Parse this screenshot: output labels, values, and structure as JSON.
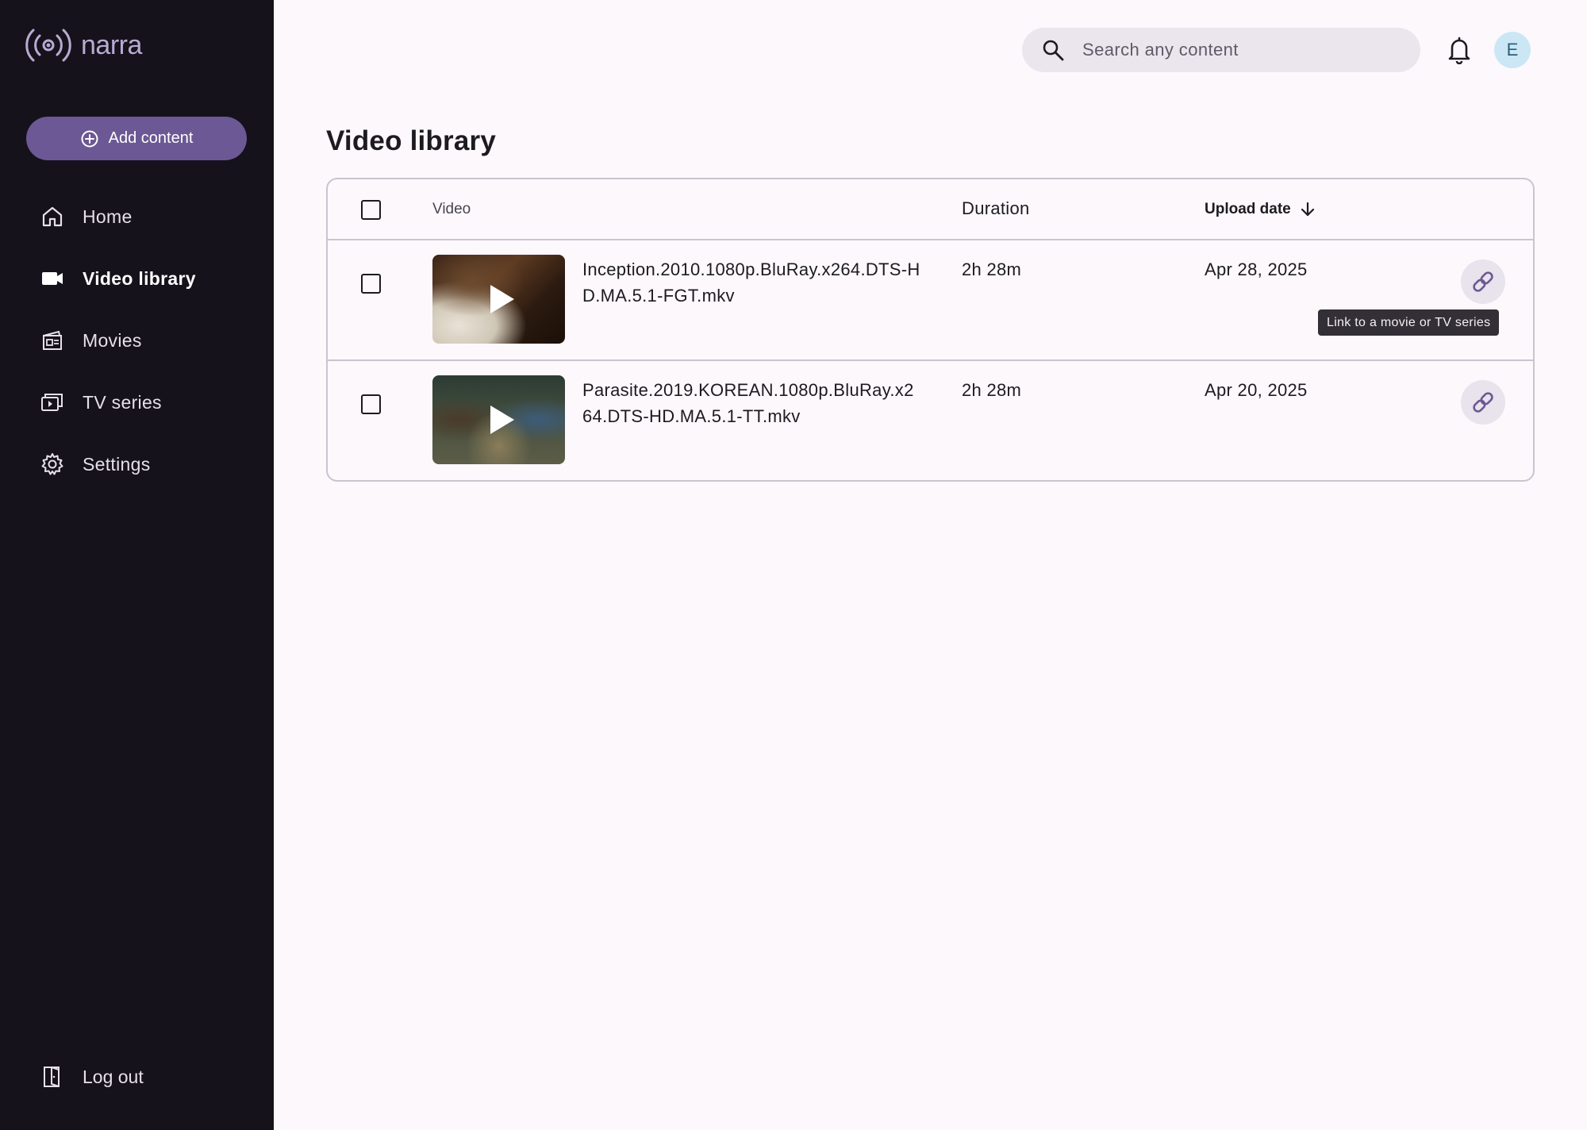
{
  "app": {
    "name": "narra",
    "colors": {
      "sidebar_bg": "#15121b",
      "accent": "#6c5894",
      "page_bg": "#fdf8fc",
      "avatar_bg": "#cbe7f5"
    }
  },
  "sidebar": {
    "add_button": {
      "label": "Add content",
      "icon": "add-circle-icon"
    },
    "items": [
      {
        "label": "Home",
        "icon": "home-icon",
        "active": false
      },
      {
        "label": "Video library",
        "icon": "video-camera-icon",
        "active": true
      },
      {
        "label": "Movies",
        "icon": "movie-clapper-icon",
        "active": false
      },
      {
        "label": "TV series",
        "icon": "tv-series-icon",
        "active": false
      },
      {
        "label": "Settings",
        "icon": "gear-icon",
        "active": false
      }
    ],
    "logout": {
      "label": "Log out",
      "icon": "logout-icon"
    }
  },
  "header": {
    "search": {
      "placeholder": "Search any content",
      "value": ""
    },
    "notifications_icon": "bell-icon",
    "avatar_initial": "E"
  },
  "main": {
    "title": "Video library",
    "table": {
      "columns": {
        "video": "Video",
        "duration": "Duration",
        "upload_date": "Upload date"
      },
      "sort": {
        "column": "upload_date",
        "direction": "descending"
      },
      "rows": [
        {
          "filename": "Inception.2010.1080p.BluRay.x264.DTS-HD.MA.5.1-FGT.mkv",
          "duration": "2h 28m",
          "upload_date": "Apr 28, 2025",
          "checked": false
        },
        {
          "filename": "Parasite.2019.KOREAN.1080p.BluRay.x264.DTS-HD.MA.5.1-TT.mkv",
          "duration": "2h 28m",
          "upload_date": "Apr 20, 2025",
          "checked": false
        }
      ],
      "link_tooltip": "Link to a movie or TV series"
    }
  }
}
